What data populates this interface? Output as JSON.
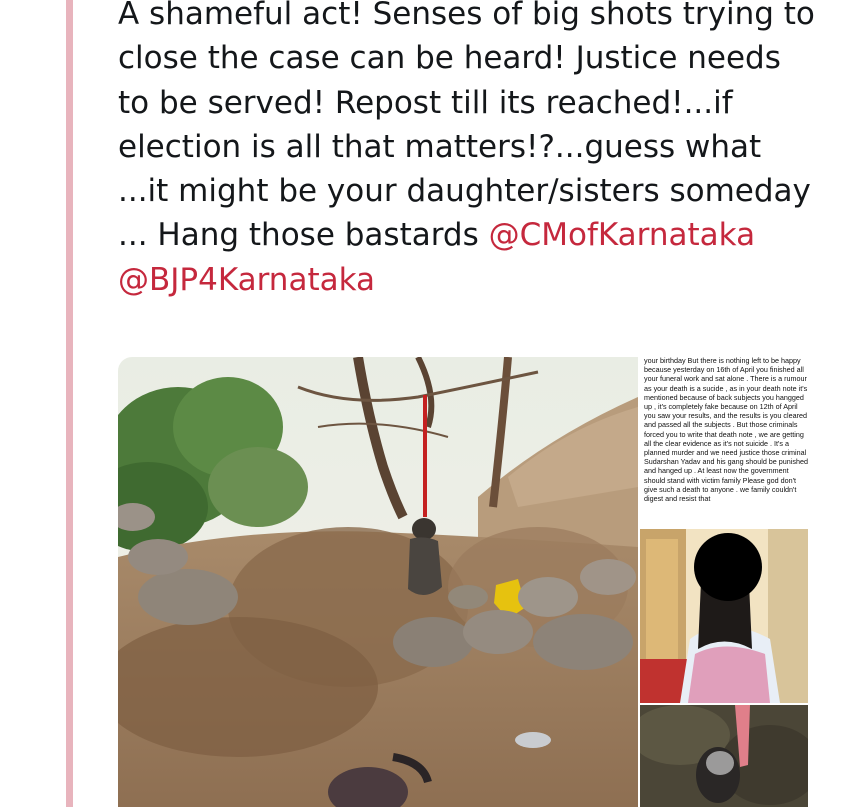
{
  "tweet": {
    "body_text": "A shameful act! Senses of big shots trying to close the case can be heard! Justice needs to be served! Repost till its reached!...if election is all that matters!?...guess what ...it might be your daughter/sisters someday ... Hang those bastards ",
    "mentions": [
      "@CMofKarnataka",
      "@BJP4Karnataka"
    ],
    "accent_color": "#c5283d",
    "thread_line_color": "#e8b4bd"
  },
  "media": {
    "note_text": "your birthday But there is nothing left to be happy because yesterday on 16th of April you finished all your funeral work and sat alone . There is a rumour as your death is a sucide , as in your death note it's mentioned because of back subjects you hangged up , it's completely fake because on 12th of April you saw your results, and the results is you cleared and passed all the subjects . But those criminals forced you to write that death note , we are getting all the clear evidence as it's not suicide . It's a planned murder and we need justice those criminal Sudarshan Yadav and his gang should be punished and hanged up . At least now the government should stand with victim family Please god don't give such a death to anyone . we family couldn't digest and resist that"
  }
}
